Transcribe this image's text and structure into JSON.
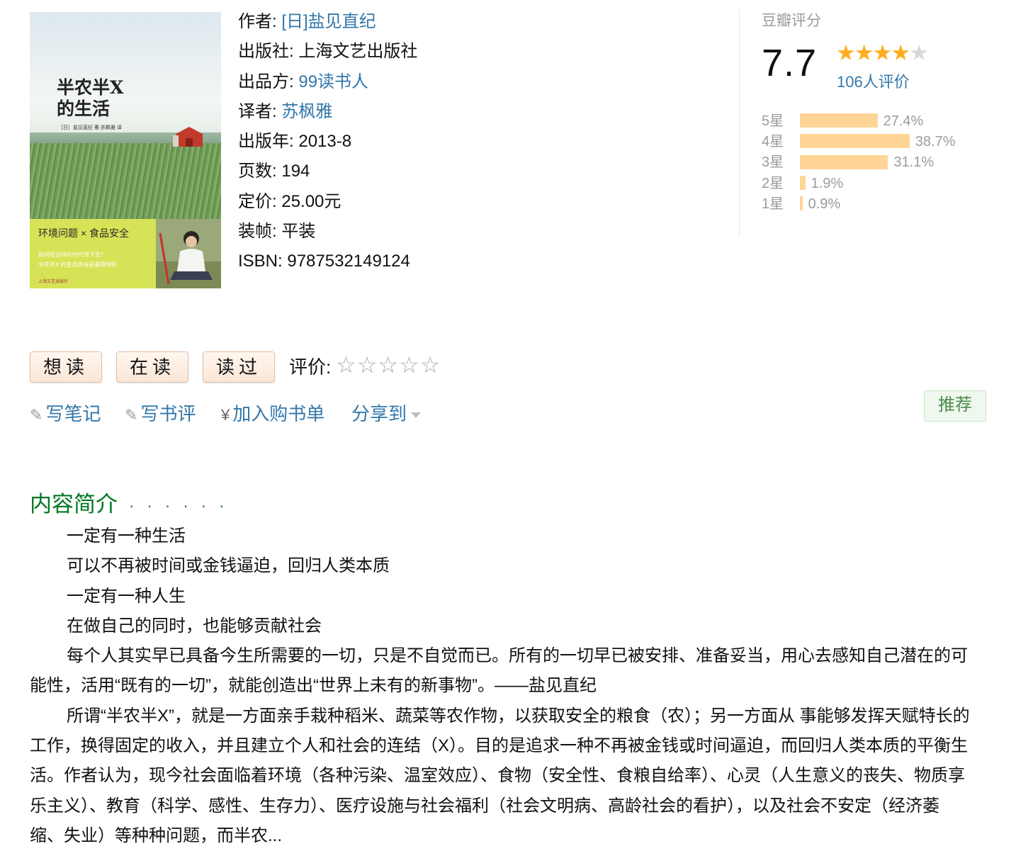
{
  "cover": {
    "title_line1": "半农半X",
    "title_line2": "的生活",
    "author_line": "［日］盐见直纪 著   苏枫雅 译",
    "band_heading": "环境问题 × 食品安全",
    "band_sub1": "如何在这样的时代活下去？",
    "band_sub2": "半农半X 的生活将会是最理想的",
    "publisher_mark": "上海文艺出版社"
  },
  "info": {
    "author_label": "作者:",
    "author": "[日]盐见直纪",
    "publisher_label": "出版社:",
    "publisher": "上海文艺出版社",
    "producer_label": "出品方:",
    "producer": "99读书人",
    "translator_label": "译者:",
    "translator": "苏枫雅",
    "year_label": "出版年:",
    "year": "2013-8",
    "pages_label": "页数:",
    "pages": "194",
    "price_label": "定价:",
    "price": "25.00元",
    "binding_label": "装帧:",
    "binding": "平装",
    "isbn_label": "ISBN:",
    "isbn": "9787532149124"
  },
  "rating": {
    "title": "豆瓣评分",
    "score": "7.7",
    "stars": 4,
    "count_text": "106人评价",
    "distribution": [
      {
        "label": "5星",
        "percent": 27.4,
        "text": "27.4%"
      },
      {
        "label": "4星",
        "percent": 38.7,
        "text": "38.7%"
      },
      {
        "label": "3星",
        "percent": 31.1,
        "text": "31.1%"
      },
      {
        "label": "2星",
        "percent": 1.9,
        "text": "1.9%"
      },
      {
        "label": "1星",
        "percent": 0.9,
        "text": "0.9%"
      }
    ],
    "bar_color": "#ffd596",
    "star_color": "#ffad1f"
  },
  "actions": {
    "want": "想读",
    "reading": "在读",
    "read": "读过",
    "rate_label": "评价:",
    "rate_stars": "☆☆☆☆☆"
  },
  "links": {
    "note": "写笔记",
    "review": "写书评",
    "cart": "加入购书单",
    "share": "分享到",
    "recommend": "推荐"
  },
  "intro": {
    "heading": "内容简介",
    "dots": "· · · · · ·",
    "paragraphs": [
      "一定有一种生活",
      "可以不再被时间或金钱逼迫，回归人类本质",
      "一定有一种人生",
      "在做自己的同时，也能够贡献社会",
      "每个人其实早已具备今生所需要的一切，只是不自觉而已。所有的一切早已被安排、准备妥当，用心去感知自己潜在的可能性，活用“既有的一切”，就能创造出“世界上未有的新事物”。——盐见直纪",
      "所谓“半农半X”，就是一方面亲手栽种稻米、蔬菜等农作物，以获取安全的粮食（农）；另一方面从 事能够发挥天赋特长的工作，换得固定的收入，并且建立个人和社会的连结（X）。目的是追求一种不再被金钱或时间逼迫，而回归人类本质的平衡生活。作者认为，现今社会面临着环境（各种污染、温室效应）、食物（安全性、食粮自给率）、心灵（人生意义的丧失、物质享乐主义）、教育（科学、感性、生存力）、医疗设施与社会福利（社会文明病、高龄社会的看护），以及社会不安定（经济萎缩、失业）等种种问题，而半农..."
    ]
  }
}
